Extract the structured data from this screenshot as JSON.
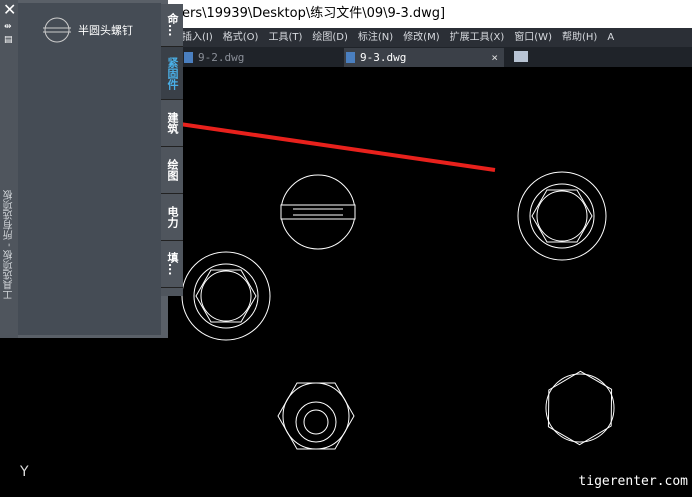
{
  "title": "ers\\19939\\Desktop\\练习文件\\09\\9-3.dwg]",
  "menu": [
    "插入(I)",
    "格式(O)",
    "工具(T)",
    "绘图(D)",
    "标注(N)",
    "修改(M)",
    "扩展工具(X)",
    "窗口(W)",
    "帮助(H)",
    "A"
  ],
  "doc_tabs": [
    {
      "label": "9-2.dwg"
    },
    {
      "label": "9-3.dwg",
      "close": "×"
    }
  ],
  "palette": {
    "title": "工具选项板 - 所有选项板",
    "item": "半圆头螺钉",
    "tabs": [
      "命...",
      "紧固件",
      "建筑",
      "绘图",
      "电力",
      "填..."
    ]
  },
  "axis_label": "Y",
  "watermark": "tigerenter.com",
  "colors": {
    "arrow": "#e8211c",
    "active_tab": "#4ab0e8"
  }
}
